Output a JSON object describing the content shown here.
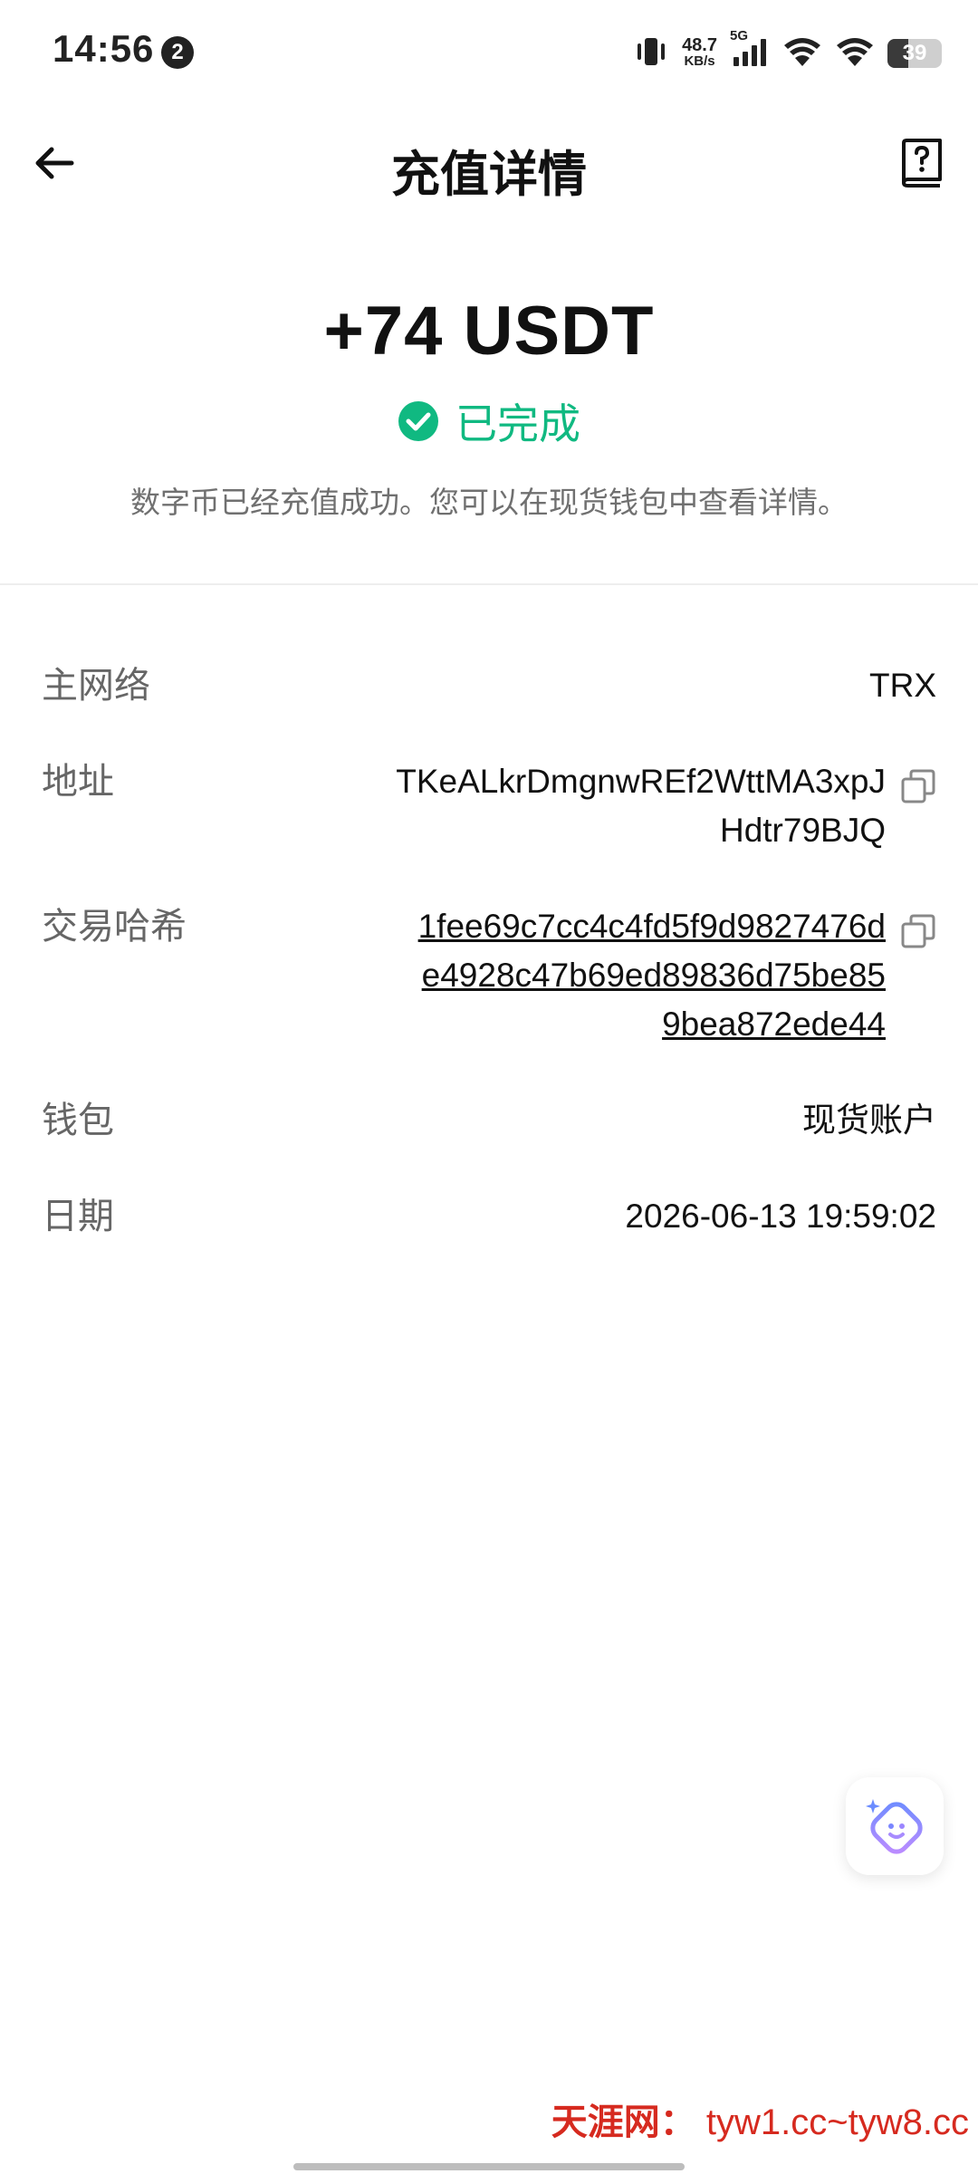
{
  "status_bar": {
    "time": "14:56",
    "notification_count": "2",
    "net_speed_value": "48.7",
    "net_speed_unit": "KB/s",
    "network_type": "5G",
    "battery": "39",
    "battery_level": 0.39
  },
  "header": {
    "title": "充值详情",
    "back_icon": "arrow-left-icon",
    "help_icon": "question-book-icon"
  },
  "summary": {
    "amount": "+74 USDT",
    "status": "已完成",
    "status_color": "#10b981",
    "description": "数字币已经充值成功。您可以在现货钱包中查看详情。"
  },
  "details": {
    "network": {
      "label": "主网络",
      "value": "TRX"
    },
    "address": {
      "label": "地址",
      "value_line1": "TKeALkrDmgnwREf2WttMA3xpJ",
      "value_line2": "Hdtr79BJQ"
    },
    "tx_hash": {
      "label": "交易哈希",
      "value_line1": "1fee69c7cc4c4fd5f9d9827476d",
      "value_line2": "e4928c47b69ed89836d75be85",
      "value_line3": "9bea872ede44"
    },
    "wallet": {
      "label": "钱包",
      "value": "现货账户"
    },
    "date": {
      "label": "日期",
      "value": "2026-06-13 19:59:02"
    }
  },
  "watermark": {
    "cn": "天涯网：",
    "url": "tyw1.cc~tyw8.cc"
  }
}
